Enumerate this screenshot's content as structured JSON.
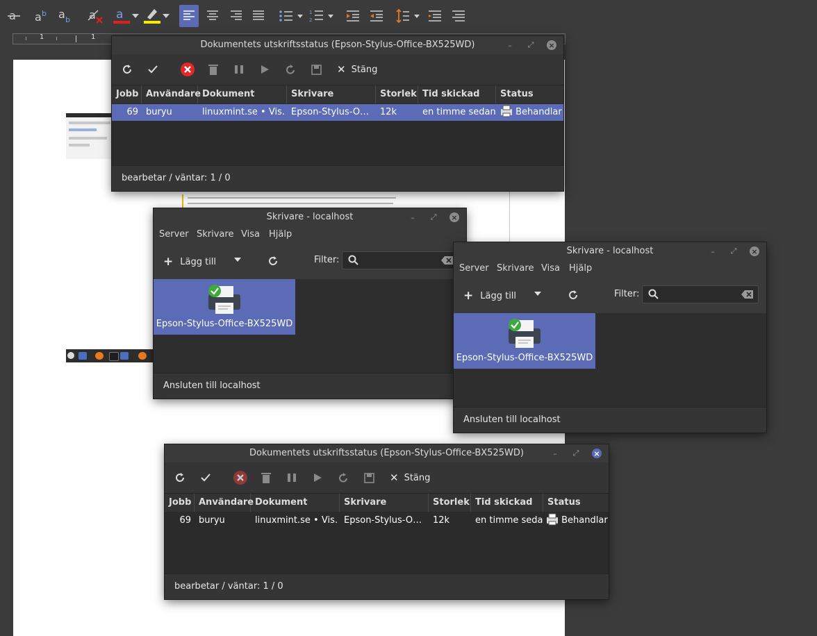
{
  "writer": {
    "ruler": {
      "marks": [
        "1",
        "1"
      ]
    },
    "taskbar_icons": [
      "menu-icon",
      "files-icon",
      "firefox-icon",
      "terminal-icon",
      "folder-icon",
      "firefox-icon"
    ]
  },
  "colors": {
    "accent": "#5b6bb5",
    "window_bg": "#2e2e2e",
    "titlebar_bg": "#3a3a3a",
    "font_color_red": "#e02020",
    "highlight_yellow": "#ffe800",
    "cancel_red": "#e02a2a"
  },
  "job_window_top": {
    "title": "Dokumentets utskriftsstatus (Epson-Stylus-Office-BX525WD)",
    "close_label": "Stäng",
    "columns": [
      "Jobb",
      "Användare",
      "Dokument",
      "Skrivare",
      "Storlek",
      "Tid skickad",
      "Status"
    ],
    "row": {
      "jobb": "69",
      "user": "buryu",
      "document": "linuxmint.se • Vis…",
      "printer": "Epson-Stylus-O…",
      "size": "12k",
      "time": "en timme sedan",
      "status": "Behandlar"
    },
    "status": "bearbetar / väntar: 1 / 0"
  },
  "printers_window_back": {
    "title": "Skrivare - localhost",
    "menu": [
      "Server",
      "Skrivare",
      "Visa",
      "Hjälp"
    ],
    "add_label": "Lägg till",
    "filter_label": "Filter:",
    "printer_name": "Epson-Stylus-Office-BX525WD",
    "status": "Ansluten till localhost"
  },
  "printers_window_front": {
    "title": "Skrivare - localhost",
    "menu": [
      "Server",
      "Skrivare",
      "Visa",
      "Hjälp"
    ],
    "add_label": "Lägg till",
    "filter_label": "Filter:",
    "printer_name": "Epson-Stylus-Office-BX525WD",
    "status": "Ansluten till localhost"
  },
  "job_window_bottom": {
    "title": "Dokumentets utskriftsstatus (Epson-Stylus-Office-BX525WD)",
    "close_label": "Stäng",
    "columns": [
      "Jobb",
      "Användare",
      "Dokument",
      "Skrivare",
      "Storlek",
      "Tid skickad",
      "Status"
    ],
    "row": {
      "jobb": "69",
      "user": "buryu",
      "document": "linuxmint.se • Vis…",
      "printer": "Epson-Stylus-O…",
      "size": "12k",
      "time": "en timme sedan",
      "status": "Behandlar"
    },
    "status": "bearbetar / väntar: 1 / 0"
  }
}
